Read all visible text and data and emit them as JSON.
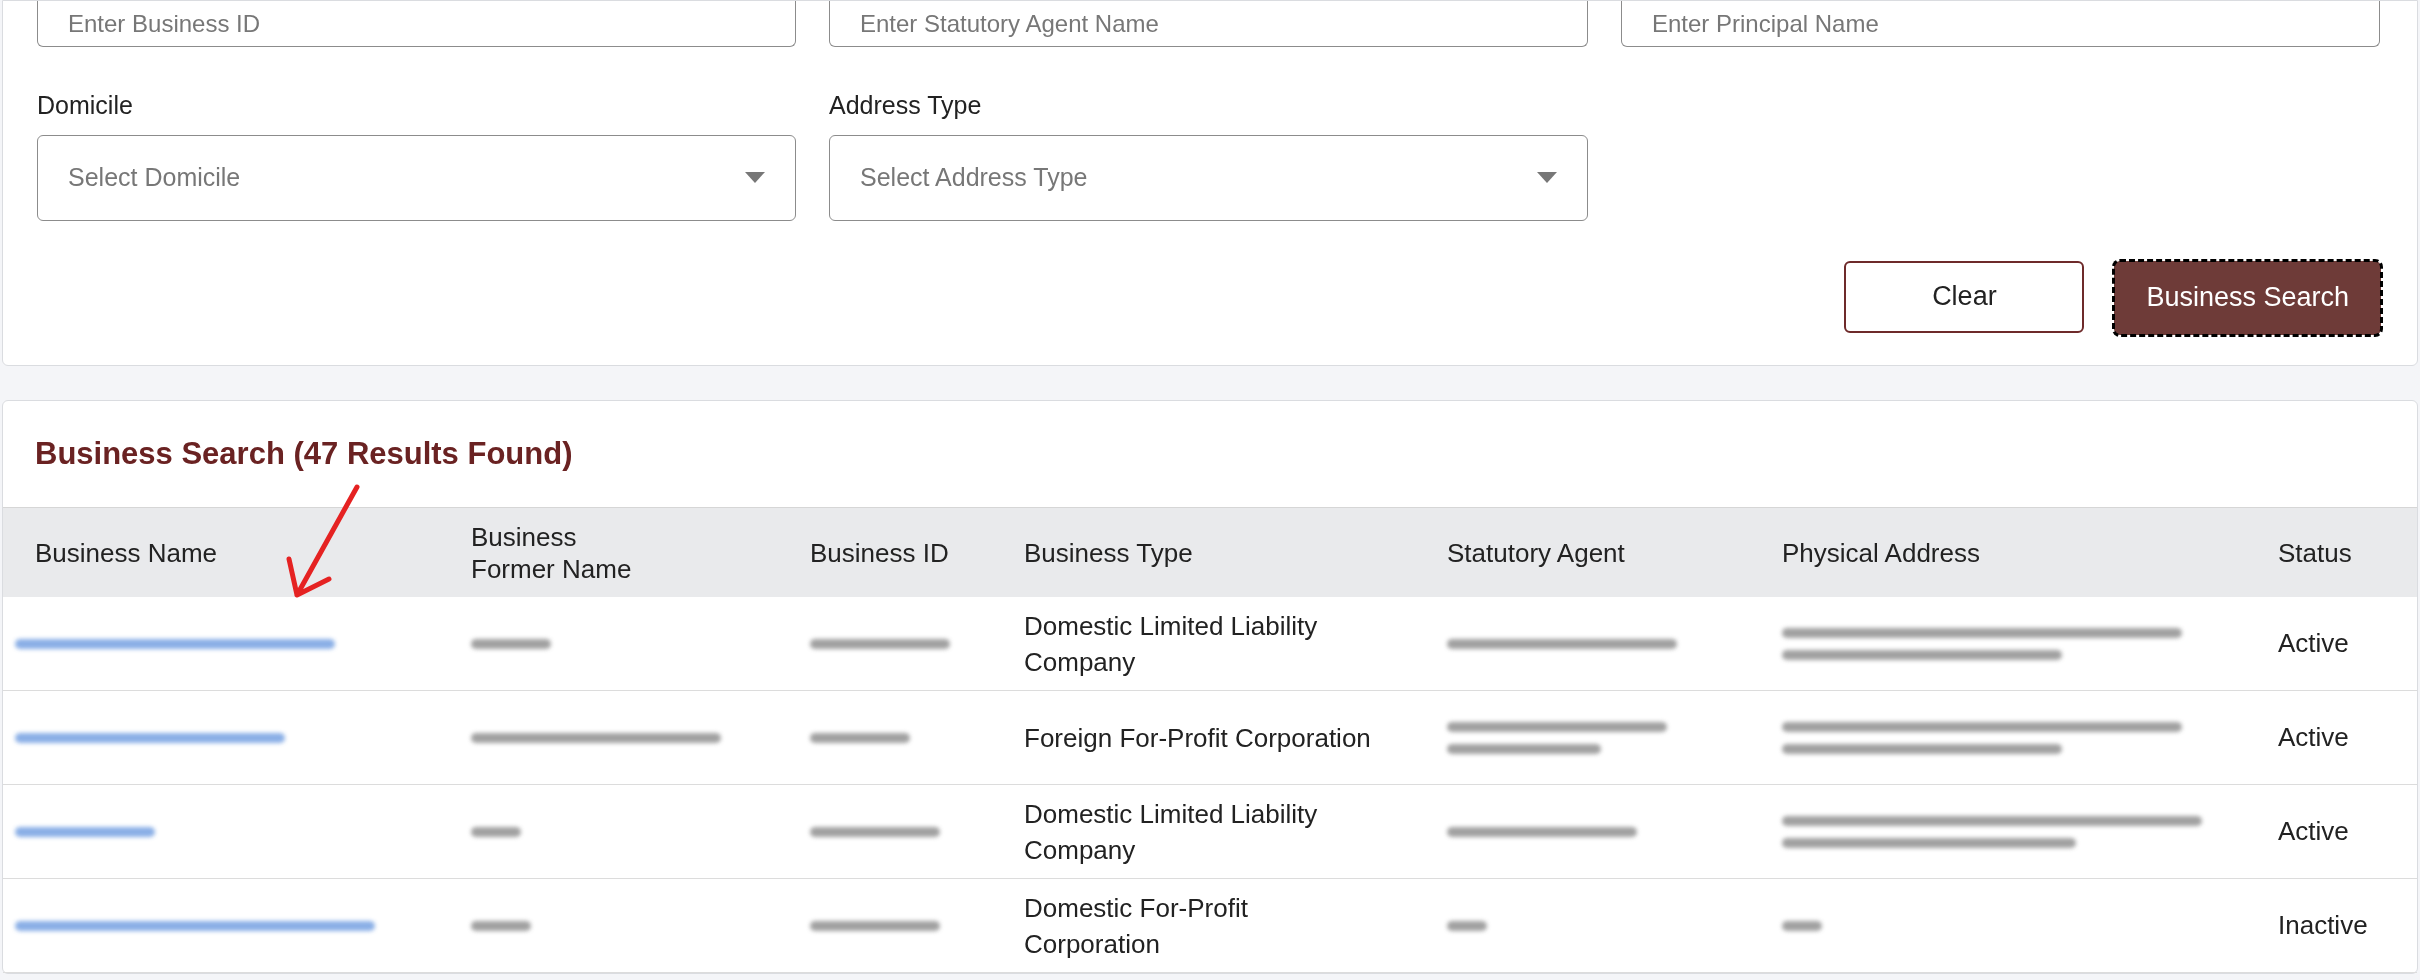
{
  "search_form": {
    "top_fields": [
      {
        "placeholder": "Enter Business ID"
      },
      {
        "placeholder": "Enter Statutory Agent Name"
      },
      {
        "placeholder": "Enter Principal Name"
      }
    ],
    "selects": [
      {
        "label": "Domicile",
        "placeholder": "Select Domicile"
      },
      {
        "label": "Address Type",
        "placeholder": "Select Address Type"
      }
    ],
    "buttons": [
      {
        "label": "Clear",
        "kind": "secondary"
      },
      {
        "label": "Business Search",
        "kind": "primary"
      }
    ]
  },
  "results": {
    "title": "Business Search (47 Results Found)",
    "table": {
      "columns": [
        "Business Name",
        "Business Former Name",
        "Business ID",
        "Business Type",
        "Statutory Agent",
        "Physical Address",
        "Status"
      ],
      "rows": [
        {
          "business_type": "Domestic Limited Liability Company",
          "status": "Active"
        },
        {
          "business_type": "Foreign For-Profit Corporation",
          "status": "Active"
        },
        {
          "business_type": "Domestic Limited Liability Company",
          "status": "Active"
        },
        {
          "business_type": "Domestic For-Profit Corporation",
          "status": "Inactive"
        }
      ]
    }
  }
}
